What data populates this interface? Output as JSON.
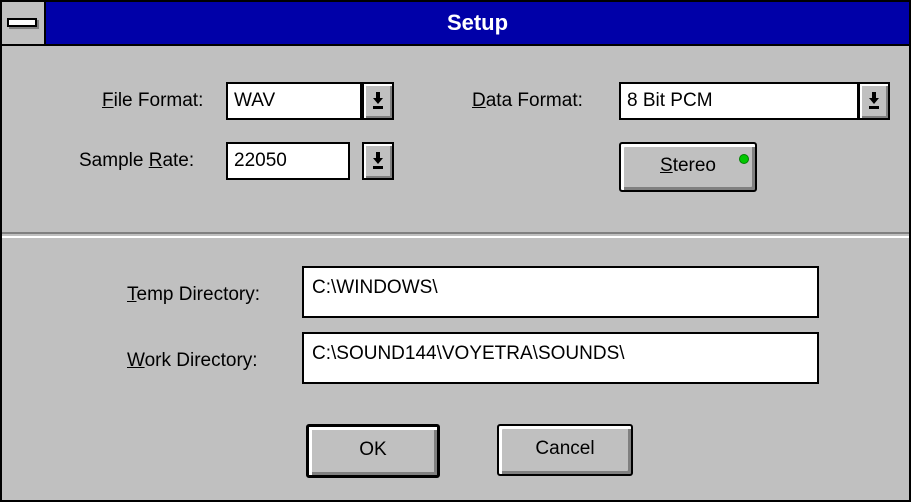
{
  "window": {
    "title": "Setup"
  },
  "audio": {
    "file_format": {
      "label_key": "F",
      "label_rest": "ile Format:",
      "value": "WAV"
    },
    "sample_rate": {
      "label_pre": "Sample ",
      "label_key": "R",
      "label_rest": "ate:",
      "value": "22050"
    },
    "data_format": {
      "label_key": "D",
      "label_rest": "ata Format:",
      "value": "8 Bit PCM"
    },
    "stereo": {
      "label_key": "S",
      "label_rest": "tereo",
      "indicator_color": "#00c800"
    }
  },
  "directories": {
    "temp": {
      "label_key": "T",
      "label_rest": "emp Directory:",
      "value": "C:\\WINDOWS\\"
    },
    "work": {
      "label_key": "W",
      "label_rest": "ork Directory:",
      "value": "C:\\SOUND144\\VOYETRA\\SOUNDS\\"
    }
  },
  "buttons": {
    "ok": "OK",
    "cancel": "Cancel"
  },
  "icons": {
    "dropdown": "arrow-down-icon",
    "system_menu": "system-menu-icon",
    "stereo_led": "led-indicator-icon"
  }
}
